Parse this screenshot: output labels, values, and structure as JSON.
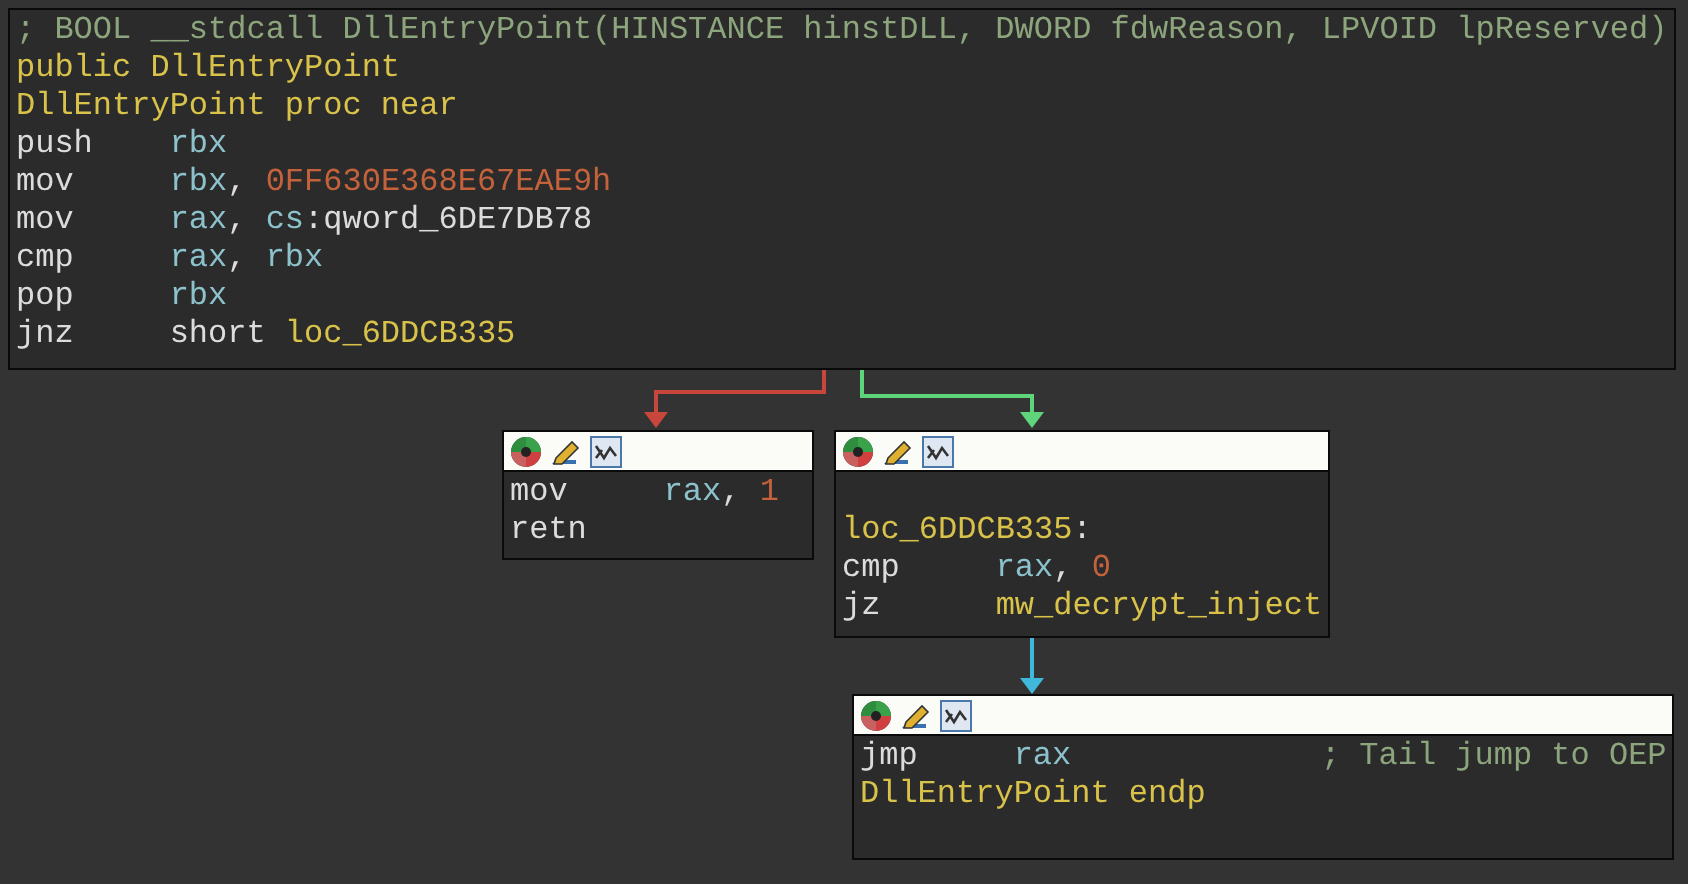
{
  "graph": {
    "nodes": [
      {
        "header": false,
        "lines": [
          {
            "kind": "text",
            "tokens": [
              {
                "kind": "comment",
                "text": "; BOOL __stdcall DllEntryPoint(HINSTANCE hinstDLL, DWORD fdwReason, LPVOID lpReserved)"
              }
            ]
          },
          {
            "kind": "text",
            "tokens": [
              {
                "kind": "name",
                "text": "public DllEntryPoint"
              }
            ]
          },
          {
            "kind": "text",
            "tokens": [
              {
                "kind": "name",
                "text": "DllEntryPoint proc near"
              }
            ]
          },
          {
            "kind": "instr",
            "mnemonic": "push",
            "tokens": [
              {
                "kind": "register",
                "text": "rbx"
              }
            ]
          },
          {
            "kind": "instr",
            "mnemonic": "mov",
            "tokens": [
              {
                "kind": "register",
                "text": "rbx"
              },
              {
                "kind": "plain",
                "text": ", "
              },
              {
                "kind": "number",
                "text": "0FF630E368E67EAE9h"
              }
            ]
          },
          {
            "kind": "instr",
            "mnemonic": "mov",
            "tokens": [
              {
                "kind": "register",
                "text": "rax"
              },
              {
                "kind": "plain",
                "text": ", "
              },
              {
                "kind": "register",
                "text": "cs"
              },
              {
                "kind": "plain",
                "text": ":qword_6DE7DB78"
              }
            ]
          },
          {
            "kind": "instr",
            "mnemonic": "cmp",
            "tokens": [
              {
                "kind": "register",
                "text": "rax"
              },
              {
                "kind": "plain",
                "text": ", "
              },
              {
                "kind": "register",
                "text": "rbx"
              }
            ]
          },
          {
            "kind": "instr",
            "mnemonic": "pop",
            "tokens": [
              {
                "kind": "register",
                "text": "rbx"
              }
            ]
          },
          {
            "kind": "instr",
            "mnemonic": "jnz",
            "tokens": [
              {
                "kind": "plain",
                "text": "short "
              },
              {
                "kind": "name",
                "text": "loc_6DDCB335"
              }
            ]
          }
        ]
      },
      {
        "header": true,
        "lines": [
          {
            "kind": "instr",
            "mnemonic": "mov",
            "tokens": [
              {
                "kind": "register",
                "text": "rax"
              },
              {
                "kind": "plain",
                "text": ", "
              },
              {
                "kind": "number",
                "text": "1"
              }
            ]
          },
          {
            "kind": "instr",
            "mnemonic": "retn"
          }
        ]
      },
      {
        "header": true,
        "lines": [
          {
            "kind": "blank"
          },
          {
            "kind": "text",
            "tokens": [
              {
                "kind": "name",
                "text": "loc_6DDCB335"
              },
              {
                "kind": "plain",
                "text": ":"
              }
            ]
          },
          {
            "kind": "instr",
            "mnemonic": "cmp",
            "tokens": [
              {
                "kind": "register",
                "text": "rax"
              },
              {
                "kind": "plain",
                "text": ", "
              },
              {
                "kind": "number",
                "text": "0"
              }
            ]
          },
          {
            "kind": "instr",
            "mnemonic": "jz",
            "tokens": [
              {
                "kind": "name",
                "text": "mw_decrypt_inject"
              }
            ]
          }
        ]
      },
      {
        "header": true,
        "lines": [
          {
            "kind": "instr",
            "mnemonic": "jmp",
            "tokens": [
              {
                "kind": "register",
                "text": "rax"
              }
            ],
            "comment": "; Tail jump to OEP"
          },
          {
            "kind": "text",
            "tokens": [
              {
                "kind": "name",
                "text": "DllEntryPoint endp"
              }
            ]
          }
        ]
      }
    ],
    "edges": [
      {
        "color": "#c8463c"
      },
      {
        "color": "#5fd47a"
      },
      {
        "color": "#3fb8dc"
      }
    ]
  }
}
